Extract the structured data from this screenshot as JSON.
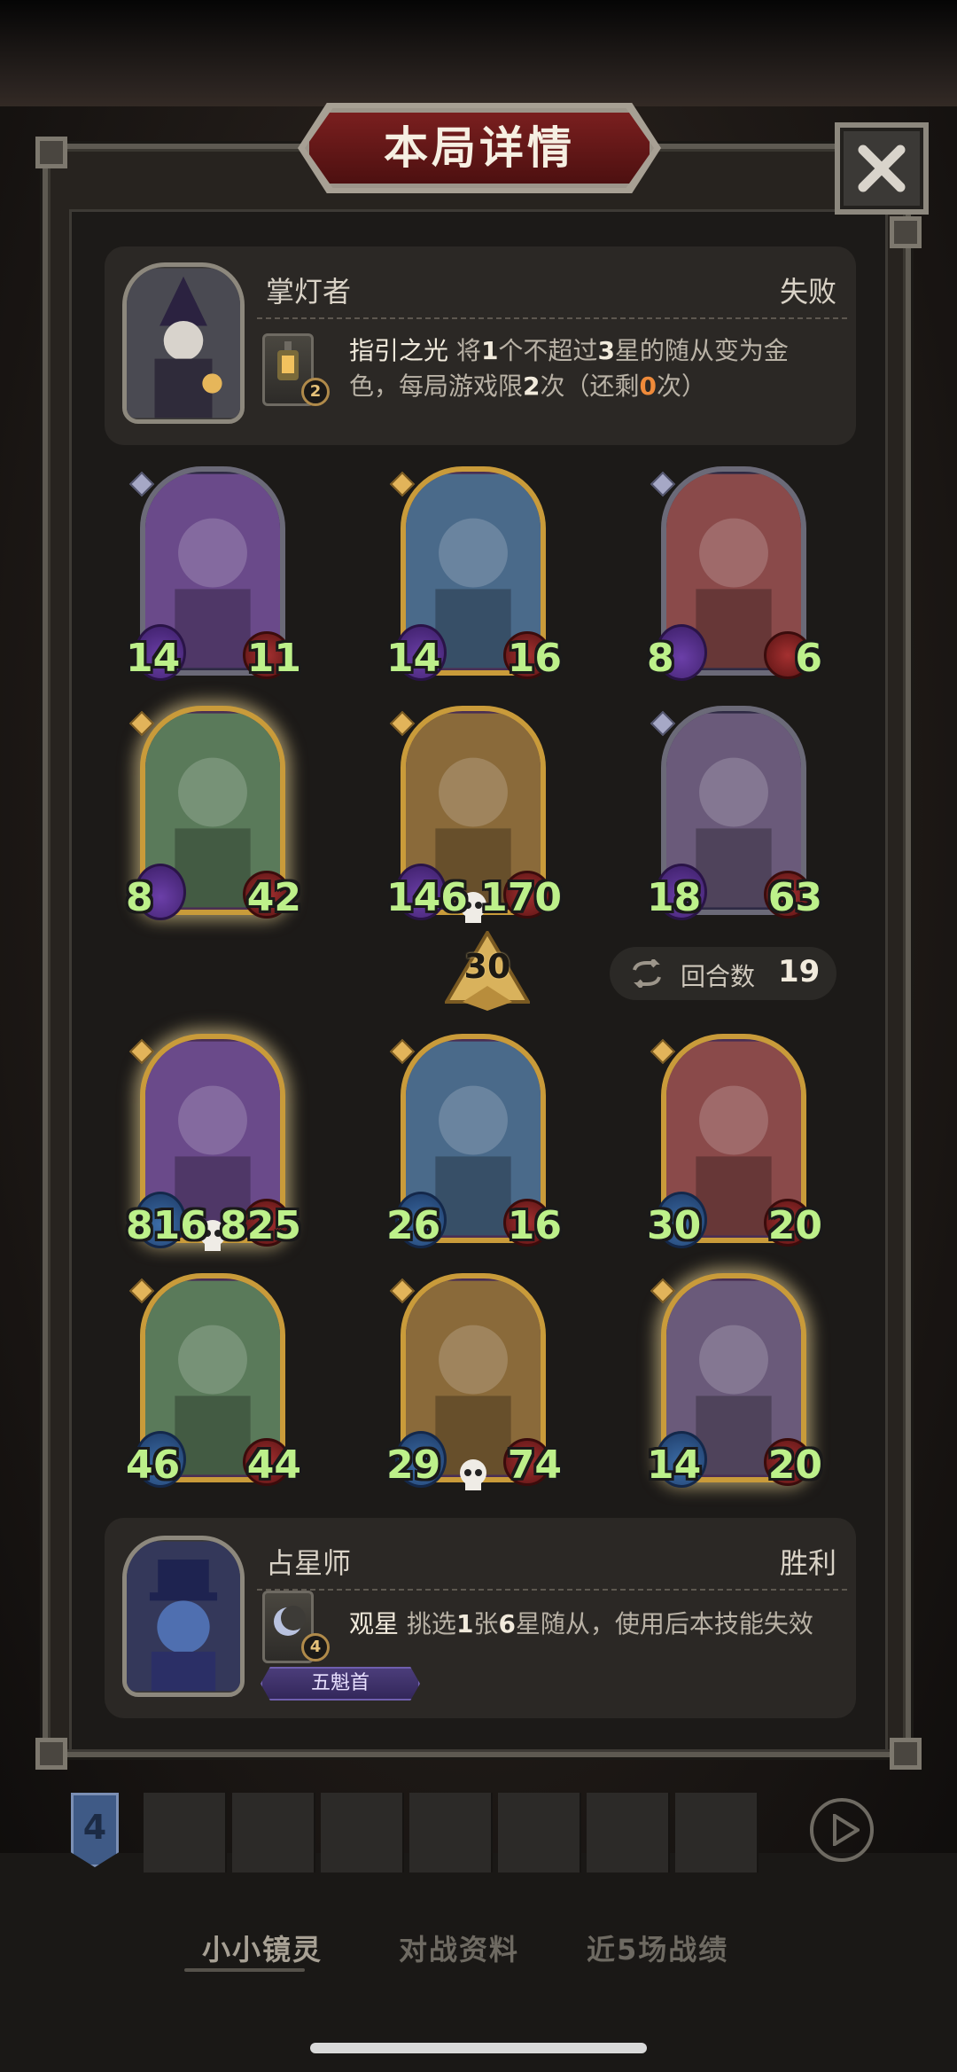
{
  "title": "本局详情",
  "close_icon": "close-icon",
  "player_top": {
    "hero_name": "掌灯者",
    "result": "失败",
    "skill_badge": "2",
    "skill_name": "指引之光",
    "skill_parts": [
      "将",
      "1",
      "个不超过",
      "3",
      "星的随从变为金色，每局游戏限",
      "2",
      "次（还剩",
      "0",
      "次）"
    ]
  },
  "enemy_minions": [
    {
      "atk": "14",
      "hp": "11",
      "tier": "silver",
      "glow": false,
      "skull": false
    },
    {
      "atk": "14",
      "hp": "16",
      "tier": "gold",
      "glow": false,
      "skull": false
    },
    {
      "atk": "8",
      "hp": "6",
      "tier": "silver",
      "glow": false,
      "skull": false
    },
    {
      "atk": "8",
      "hp": "42",
      "tier": "gold",
      "glow": true,
      "skull": false
    },
    {
      "atk": "146",
      "hp": "170",
      "tier": "gold",
      "glow": false,
      "skull": true
    },
    {
      "atk": "18",
      "hp": "63",
      "tier": "silver",
      "glow": false,
      "skull": false
    }
  ],
  "damage": "30",
  "rounds": {
    "label": "回合数",
    "value": "19"
  },
  "player_minions": [
    {
      "atk": "816",
      "hp": "825",
      "tier": "gold",
      "glow": true,
      "skull": true
    },
    {
      "atk": "26",
      "hp": "16",
      "tier": "gold",
      "glow": false,
      "skull": false
    },
    {
      "atk": "30",
      "hp": "20",
      "tier": "gold",
      "glow": false,
      "skull": false
    },
    {
      "atk": "46",
      "hp": "44",
      "tier": "gold",
      "glow": false,
      "skull": false
    },
    {
      "atk": "29",
      "hp": "74",
      "tier": "gold",
      "glow": false,
      "skull": true
    },
    {
      "atk": "14",
      "hp": "20",
      "tier": "gold",
      "glow": true,
      "skull": false
    }
  ],
  "player_bottom": {
    "hero_name": "占星师",
    "result": "胜利",
    "skill_badge": "4",
    "skill_name": "观星",
    "skill_desc_parts": [
      "挑选",
      "1",
      "张",
      "6",
      "星随从，使用后本技能失效"
    ],
    "title_tag": "五魁首"
  },
  "hero_bar": {
    "rank": "4"
  },
  "tabs": {
    "tab1": "小小镜灵",
    "tab2": "对战资料",
    "tab3": "近5场战绩"
  },
  "colors": {
    "stat_green": "#bdf08a",
    "gold_frame": "#c99b3a",
    "title_red": "#7a1f1f",
    "highlight_orange": "#ef8a3a"
  }
}
